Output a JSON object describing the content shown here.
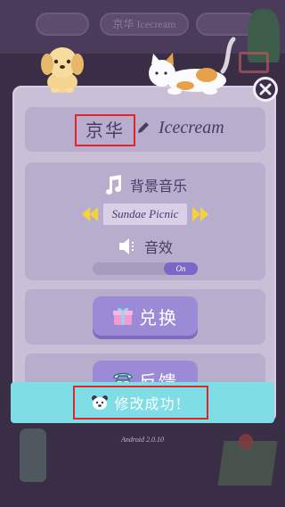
{
  "background": {
    "top_chip_text": "京华 Icecream"
  },
  "profile": {
    "name": "京华",
    "value": "Icecream"
  },
  "audio": {
    "music_label": "背景音乐",
    "track_name": "Sundae Picnic",
    "sfx_label": "音效",
    "sfx_toggle": "On"
  },
  "redeem": {
    "label": "兑换"
  },
  "feedback": {
    "label": "反馈"
  },
  "toast": {
    "message": "修改成功！"
  },
  "footer": {
    "version": "Android 2.0.10"
  },
  "colors": {
    "panel": "#c9c0d8",
    "section": "#b8adcd",
    "button": "#9b8ad6",
    "toast": "#7fdde5",
    "highlight": "#e0262a"
  },
  "icons": [
    "dog-icon",
    "cat-icon",
    "close-icon",
    "pencil-icon",
    "music-note-icon",
    "arrow-left-icon",
    "arrow-right-icon",
    "speaker-icon",
    "gift-icon",
    "phone-icon",
    "bear-icon"
  ]
}
